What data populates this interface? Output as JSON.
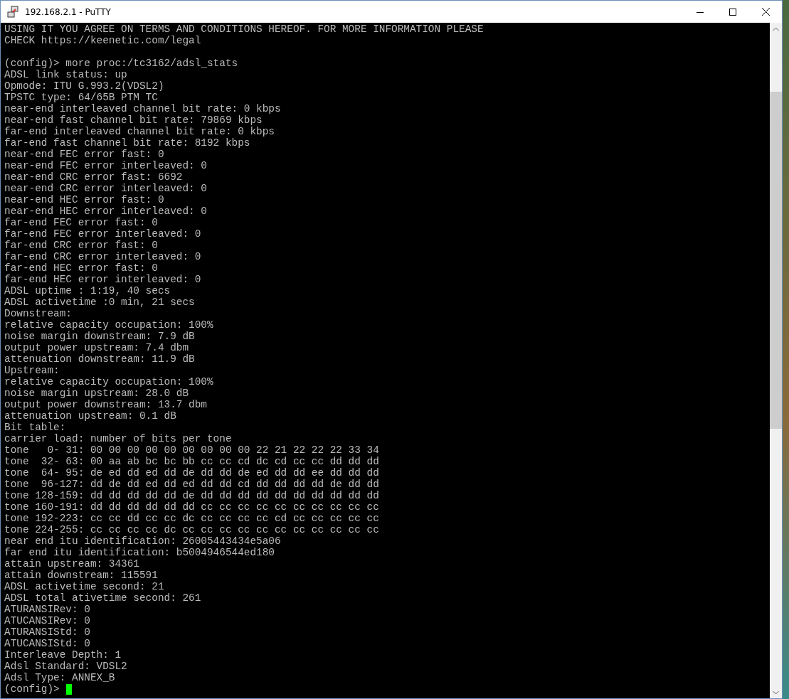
{
  "window": {
    "title": "192.168.2.1 - PuTTY"
  },
  "terminal": {
    "banner": [
      "USING IT YOU AGREE ON TERMS AND CONDITIONS HEREOF. FOR MORE INFORMATION PLEASE",
      "CHECK https://keenetic.com/legal"
    ],
    "output": [
      "(config)> more proc:/tc3162/adsl_stats",
      "ADSL link status: up",
      "Opmode: ITU G.993.2(VDSL2)",
      "TPSTC type: 64/65B PTM TC",
      "near-end interleaved channel bit rate: 0 kbps",
      "near-end fast channel bit rate: 79869 kbps",
      "far-end interleaved channel bit rate: 0 kbps",
      "far-end fast channel bit rate: 8192 kbps",
      "near-end FEC error fast: 0",
      "near-end FEC error interleaved: 0",
      "near-end CRC error fast: 6692",
      "near-end CRC error interleaved: 0",
      "near-end HEC error fast: 0",
      "near-end HEC error interleaved: 0",
      "far-end FEC error fast: 0",
      "far-end FEC error interleaved: 0",
      "far-end CRC error fast: 0",
      "far-end CRC error interleaved: 0",
      "far-end HEC error fast: 0",
      "far-end HEC error interleaved: 0",
      "ADSL uptime : 1:19, 40 secs",
      "ADSL activetime :0 min, 21 secs",
      "Downstream:",
      "relative capacity occupation: 100%",
      "noise margin downstream: 7.9 dB",
      "output power upstream: 7.4 dbm",
      "attenuation downstream: 11.9 dB",
      "Upstream:",
      "relative capacity occupation: 100%",
      "noise margin upstream: 28.0 dB",
      "output power downstream: 13.7 dbm",
      "attenuation upstream: 0.1 dB",
      "Bit table:",
      "carrier load: number of bits per tone",
      "tone   0- 31: 00 00 00 00 00 00 00 00 00 22 21 22 22 22 33 34",
      "tone  32- 63: 00 aa ab bc bc bb cc cc cd dc cd cc cc dd dd dd",
      "tone  64- 95: de ed dd ed dd de dd dd de ed dd dd ee dd dd dd",
      "tone  96-127: dd de dd ed dd ed dd dd cd dd dd dd dd de dd dd",
      "tone 128-159: dd dd dd dd dd de dd dd dd dd dd dd dd dd dd dd",
      "tone 160-191: dd dd dd dd dd dd cc cc cc cc cc cc cc cc cc cc",
      "tone 192-223: cc cc dd cc cc dc cc cc cc cc cd cc cc cc cc cc",
      "tone 224-255: cc cc cc cc dc cc cc cc cc cc cc cc cc cc cc cc",
      "near end itu identification: 26005443434e5a06",
      "far end itu identification: b5004946544ed180",
      "attain upstream: 34361",
      "attain downstream: 115591",
      "ADSL activetime second: 21",
      "ADSL total ativetime second: 261",
      "ATURANSIRev: 0",
      "ATUCANSIRev: 0",
      "ATURANSIStd: 0",
      "ATUCANSIStd: 0",
      "Interleave Depth: 1",
      "Adsl Standard: VDSL2",
      "Adsl Type: ANNEX_B"
    ],
    "prompt": "(config)>"
  }
}
